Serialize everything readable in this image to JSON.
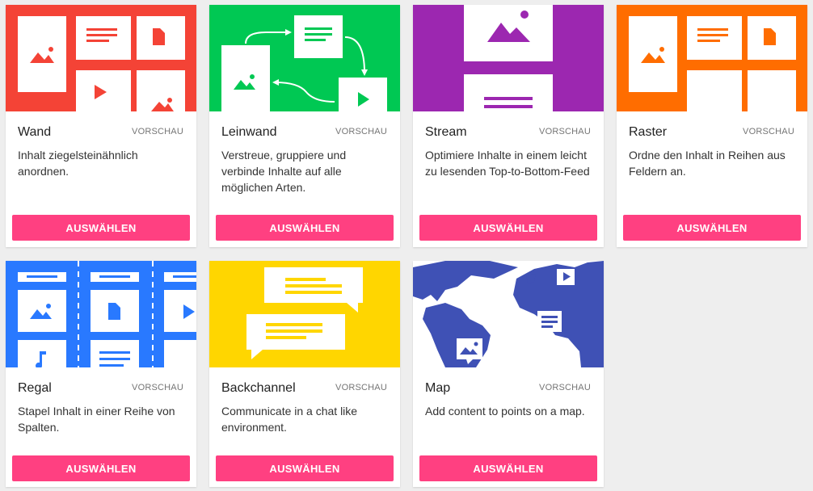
{
  "cards": [
    {
      "title": "Wand",
      "preview": "VORSCHAU",
      "description": "Inhalt ziegelsteinähnlich anordnen.",
      "button": "AUSWÄHLEN",
      "color": "#f44336"
    },
    {
      "title": "Leinwand",
      "preview": "VORSCHAU",
      "description": "Verstreue, gruppiere und verbinde Inhalte auf alle möglichen Arten.",
      "button": "AUSWÄHLEN",
      "color": "#00c853"
    },
    {
      "title": "Stream",
      "preview": "VORSCHAU",
      "description": "Optimiere Inhalte in einem leicht zu lesenden Top-to-Bottom-Feed",
      "button": "AUSWÄHLEN",
      "color": "#9c27b0"
    },
    {
      "title": "Raster",
      "preview": "VORSCHAU",
      "description": "Ordne den Inhalt in Reihen aus Feldern an.",
      "button": "AUSWÄHLEN",
      "color": "#ff6d00"
    },
    {
      "title": "Regal",
      "preview": "VORSCHAU",
      "description": "Stapel Inhalt in einer Reihe von Spalten.",
      "button": "AUSWÄHLEN",
      "color": "#2979ff"
    },
    {
      "title": "Backchannel",
      "preview": "VORSCHAU",
      "description": "Communicate in a chat like environment.",
      "button": "AUSWÄHLEN",
      "color": "#ffd600"
    },
    {
      "title": "Map",
      "preview": "VORSCHAU",
      "description": "Add content to points on a map.",
      "button": "AUSWÄHLEN",
      "color": "#3f51b5"
    }
  ],
  "icons": {
    "wand": [
      "image-icon",
      "text-icon",
      "document-icon",
      "play-icon"
    ],
    "leinwand": [
      "text-icon",
      "image-icon",
      "play-icon",
      "arrow-icon"
    ],
    "stream": [
      "image-icon",
      "text-icon"
    ],
    "raster": [
      "image-icon",
      "text-icon",
      "document-icon"
    ],
    "regal": [
      "image-icon",
      "document-icon",
      "play-icon",
      "music-icon",
      "text-icon"
    ],
    "backchannel": [
      "chat-bubble-icon"
    ],
    "map": [
      "image-icon",
      "text-icon",
      "play-icon",
      "map-pin-icon"
    ]
  }
}
